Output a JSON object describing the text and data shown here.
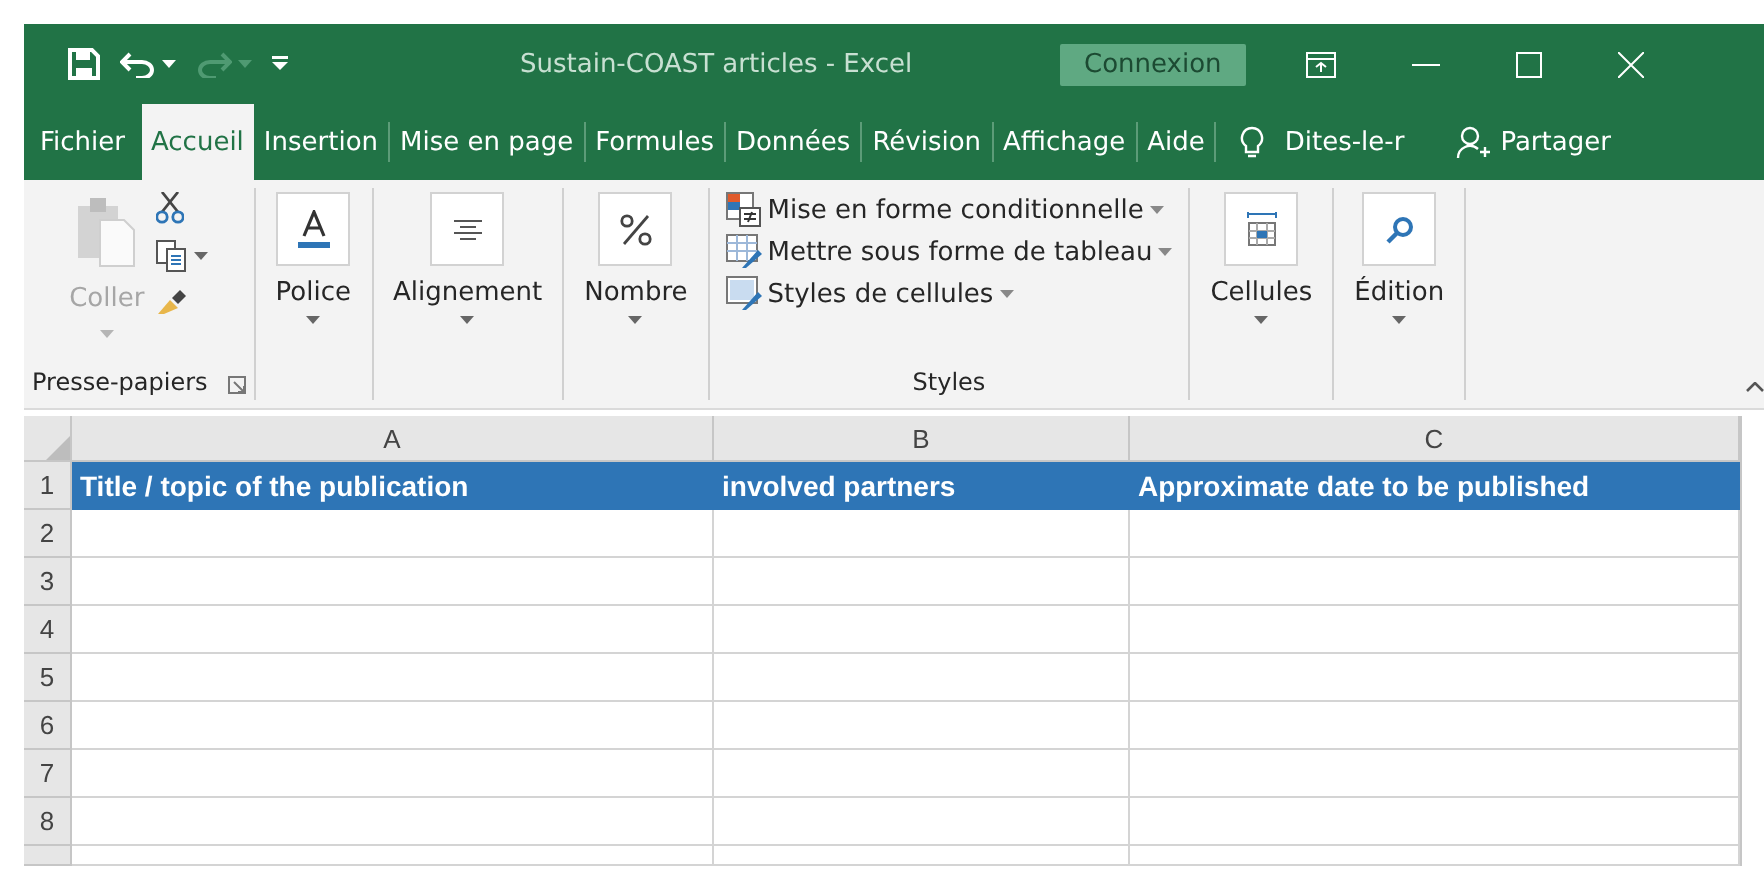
{
  "quick_access": [
    {
      "kind": "save",
      "disabled": false
    },
    {
      "kind": "undo",
      "disabled": false
    },
    {
      "kind": "redo",
      "disabled": true
    },
    {
      "kind": "customize",
      "disabled": false
    }
  ],
  "window": {
    "title": "Sustain-COAST articles  -  Excel",
    "sign_in": "Connexion"
  },
  "tabs": [
    {
      "label": "Fichier",
      "selected": false
    },
    {
      "label": "Accueil",
      "selected": true
    },
    {
      "label": "Insertion",
      "selected": false
    },
    {
      "label": "Mise en page",
      "selected": false
    },
    {
      "label": "Formules",
      "selected": false
    },
    {
      "label": "Données",
      "selected": false
    },
    {
      "label": "Révision",
      "selected": false
    },
    {
      "label": "Affichage",
      "selected": false
    },
    {
      "label": "Aide",
      "selected": false
    }
  ],
  "tell_me": "Dites-le-r",
  "share": "Partager",
  "ribbon": {
    "groups": [
      {
        "kind": "clipboard",
        "label": "Presse-papiers",
        "paste": "Coller",
        "paste_disabled": true
      },
      {
        "kind": "font",
        "button": "Police"
      },
      {
        "kind": "alignment",
        "button": "Alignement"
      },
      {
        "kind": "number",
        "button": "Nombre"
      },
      {
        "kind": "styles",
        "label": "Styles",
        "items": [
          {
            "kind": "conditional",
            "label": "Mise en forme conditionnelle"
          },
          {
            "kind": "table",
            "label": "Mettre sous forme de tableau"
          },
          {
            "kind": "cell_styles",
            "label": "Styles de cellules"
          }
        ]
      },
      {
        "kind": "cells",
        "button": "Cellules"
      },
      {
        "kind": "editing",
        "button": "Édition"
      }
    ]
  },
  "sheet": {
    "columns": [
      "A",
      "B",
      "C"
    ],
    "rows": [
      {
        "number": "1",
        "kind": "heading",
        "cells": [
          "Title / topic of the publication",
          "involved partners",
          "Approximate date to be published"
        ]
      },
      {
        "number": "2",
        "kind": "data"
      },
      {
        "number": "3",
        "kind": "data"
      },
      {
        "number": "4",
        "kind": "data"
      },
      {
        "number": "5",
        "kind": "data"
      },
      {
        "number": "6",
        "kind": "data"
      },
      {
        "number": "7",
        "kind": "data"
      },
      {
        "number": "8",
        "kind": "data"
      }
    ]
  }
}
